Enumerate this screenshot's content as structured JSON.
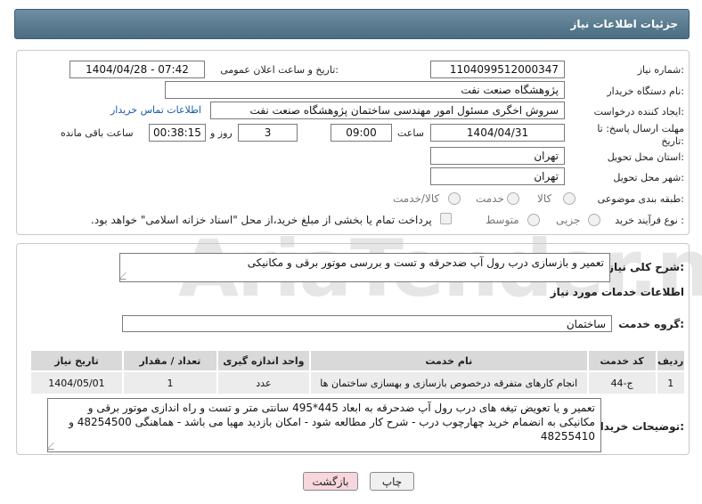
{
  "header": {
    "title": "جزئیات اطلاعات نیاز"
  },
  "form": {
    "need_number_label": "شماره نیاز:",
    "need_number": "1104099512000347",
    "announce_label": "تاریخ و ساعت اعلان عمومی:",
    "announce_value": "1404/04/28 - 07:42",
    "buyer_label": "نام دستگاه خریدار:",
    "buyer_value": "پژوهشگاه صنعت نفت",
    "creator_label": "ایجاد کننده درخواست:",
    "creator_value": "سروش اخگری مسئول امور مهندسی ساختمان پژوهشگاه صنعت نفت",
    "contact_link": "اطلاعات تماس خریدار",
    "deadline_label": "مهلت ارسال پاسخ: تا تاریخ:",
    "deadline_date": "1404/04/31",
    "time_label": "ساعت",
    "deadline_time": "09:00",
    "days_value": "3",
    "days_label": "روز و",
    "remaining_time": "00:38:15",
    "remaining_label": "ساعت باقی مانده",
    "province_label": "استان محل تحویل:",
    "province_value": "تهران",
    "city_label": "شهر محل تحویل:",
    "city_value": "تهران",
    "category_label": "طبقه بندی موضوعی:",
    "category_options": [
      "کالا",
      "خدمت",
      "کالا/خدمت"
    ],
    "process_label": "نوع فرآیند خرید :",
    "process_options": [
      "جزیی",
      "متوسط"
    ],
    "payment_note": "پرداخت تمام یا بخشی از مبلغ خرید،از محل \"اسناد خزانه اسلامی\" خواهد بود."
  },
  "summary": {
    "label": "شرح کلی نیاز:",
    "value": "تعمیر و بازسازی درب رول آپ ضدحرقه و تست و بررسی موتور برقی و مکانیکی"
  },
  "services": {
    "section_title": "اطلاعات خدمات مورد نیاز",
    "group_label": "گروه خدمت:",
    "group_value": "ساختمان",
    "columns": [
      "ردیف",
      "کد خدمت",
      "نام خدمت",
      "واحد اندازه گیری",
      "تعداد / مقدار",
      "تاریخ نیاز"
    ],
    "rows": [
      [
        "1",
        "ج-44",
        "انجام کارهای متفرقه درخصوص بازسازی و بهسازی ساختمان ها",
        "عدد",
        "1",
        "1404/05/01"
      ]
    ]
  },
  "notes": {
    "label": "توضیحات خریدار:",
    "value": "تعمیر و یا تعویض تیغه های درب رول آپ ضدحرقه به ابعاد 445*495 سانتی متر و تست و راه اندازی موتور برقی و مکانیکی به انضمام خرید چهارچوب درب - شرح کار مطالعه شود - امکان بازدید مهیا می باشد - هماهنگی 48254500 و 48255410"
  },
  "buttons": {
    "print": "چاپ",
    "back": "بازگشت"
  },
  "watermark": "AriaTender.net"
}
